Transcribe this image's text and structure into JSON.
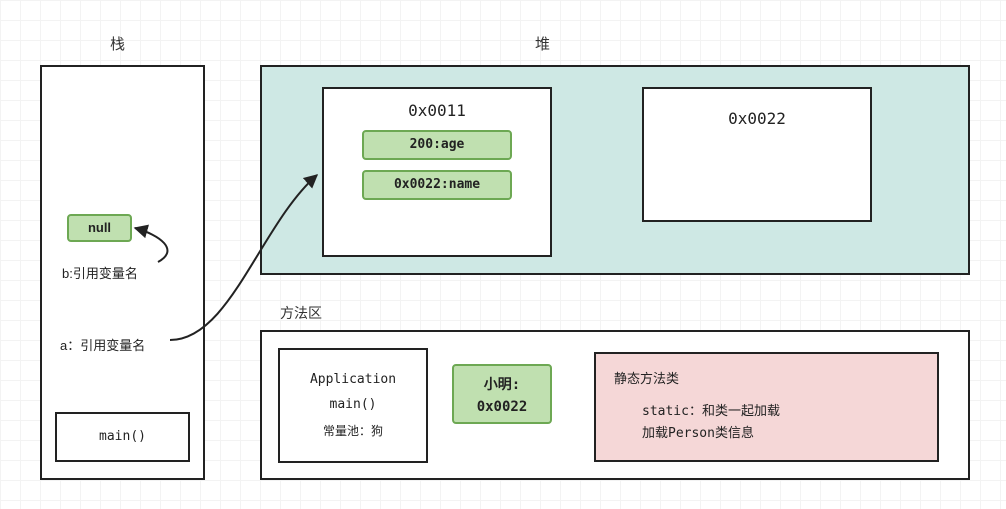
{
  "titles": {
    "stack": "栈",
    "heap": "堆",
    "method": "方法区"
  },
  "stack": {
    "nullLabel": "null",
    "bLabel": "b:引用变量名",
    "aLabel": "a：引用变量名",
    "mainFrame": "main()"
  },
  "heap": {
    "obj1": {
      "addr": "0x0011",
      "age": "200:age",
      "name": "0x0022:name"
    },
    "obj2": {
      "addr": "0x0022"
    }
  },
  "methodArea": {
    "app": {
      "title": "Application",
      "main": "main()",
      "constPool": "常量池：狗"
    },
    "nameBox": {
      "line1": "小明:",
      "line2": "0x0022"
    },
    "staticBox": {
      "title": "静态方法类",
      "line1": "static：和类一起加载",
      "line2": "加载Person类信息"
    }
  }
}
